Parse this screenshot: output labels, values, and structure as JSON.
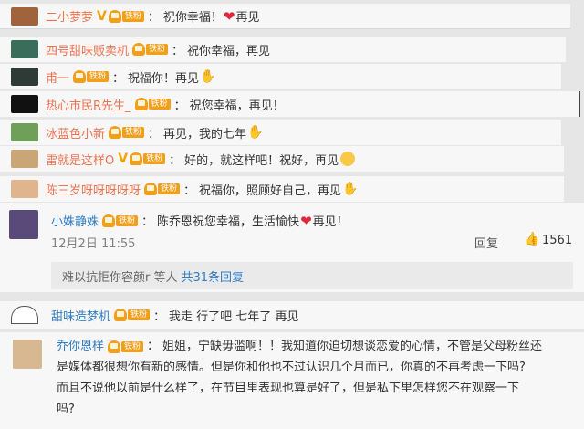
{
  "colors": {
    "name": "#eb7350",
    "link": "#2f7ec2",
    "fan_badge": "#f29f1b",
    "heart": "#e0283a"
  },
  "comments": [
    {
      "name": "二小萝萝",
      "verified": "V",
      "fan_label": "铁粉",
      "text": "祝你幸福！",
      "trail": "再见"
    },
    {
      "name": "四号甜味贩卖机",
      "fan_label": "铁粉",
      "text": "祝你幸福，再见"
    },
    {
      "name": "甫一",
      "fan_label": "铁粉",
      "text": "祝福你！再见"
    },
    {
      "name": "热心市民R先生_",
      "fan_label": "铁粉",
      "text": "祝您幸福，再见！"
    },
    {
      "name": "冰蓝色小新",
      "fan_label": "铁粉",
      "text": "再见，我的七年"
    },
    {
      "name": "雷就是这样O",
      "verified": "V",
      "fan_label": "铁粉",
      "text": "好的，就这样吧！祝好，再见"
    },
    {
      "name": "陈三岁呀呀呀呀呀",
      "fan_label": "铁粉",
      "text": "祝福你，照顾好自己，再见"
    }
  ],
  "featured": {
    "name": "小姝静姝",
    "fan_label": "铁粉",
    "text": "陈乔恩祝您幸福，生活愉快",
    "trail": "再见！",
    "date": "12月2日 11:55",
    "reply_label": "回复",
    "likes": "1561",
    "replies_prefix": "难以抗拒你容颜r 等人",
    "replies_link": "共31条回复"
  },
  "comment8": {
    "name": "甜味造梦机",
    "fan_label": "铁粉",
    "text": "我走 行了吧 七年了 再见"
  },
  "comment9": {
    "name": "乔你恩样",
    "fan_label": "铁粉",
    "line1": "姐姐，宁缺毋滥啊！！我知道你迫切想谈恋爱的心情，不管是父母粉丝还",
    "line2": "是媒体都很想你有新的感情。但是你和他也不过认识几个月而已，你真的不再考虑一下吗?",
    "line3": "而且不说他以前是什么样了，在节目里表现也算是好了，但是私下里怎样您不在观察一下",
    "line4": "吗?"
  }
}
